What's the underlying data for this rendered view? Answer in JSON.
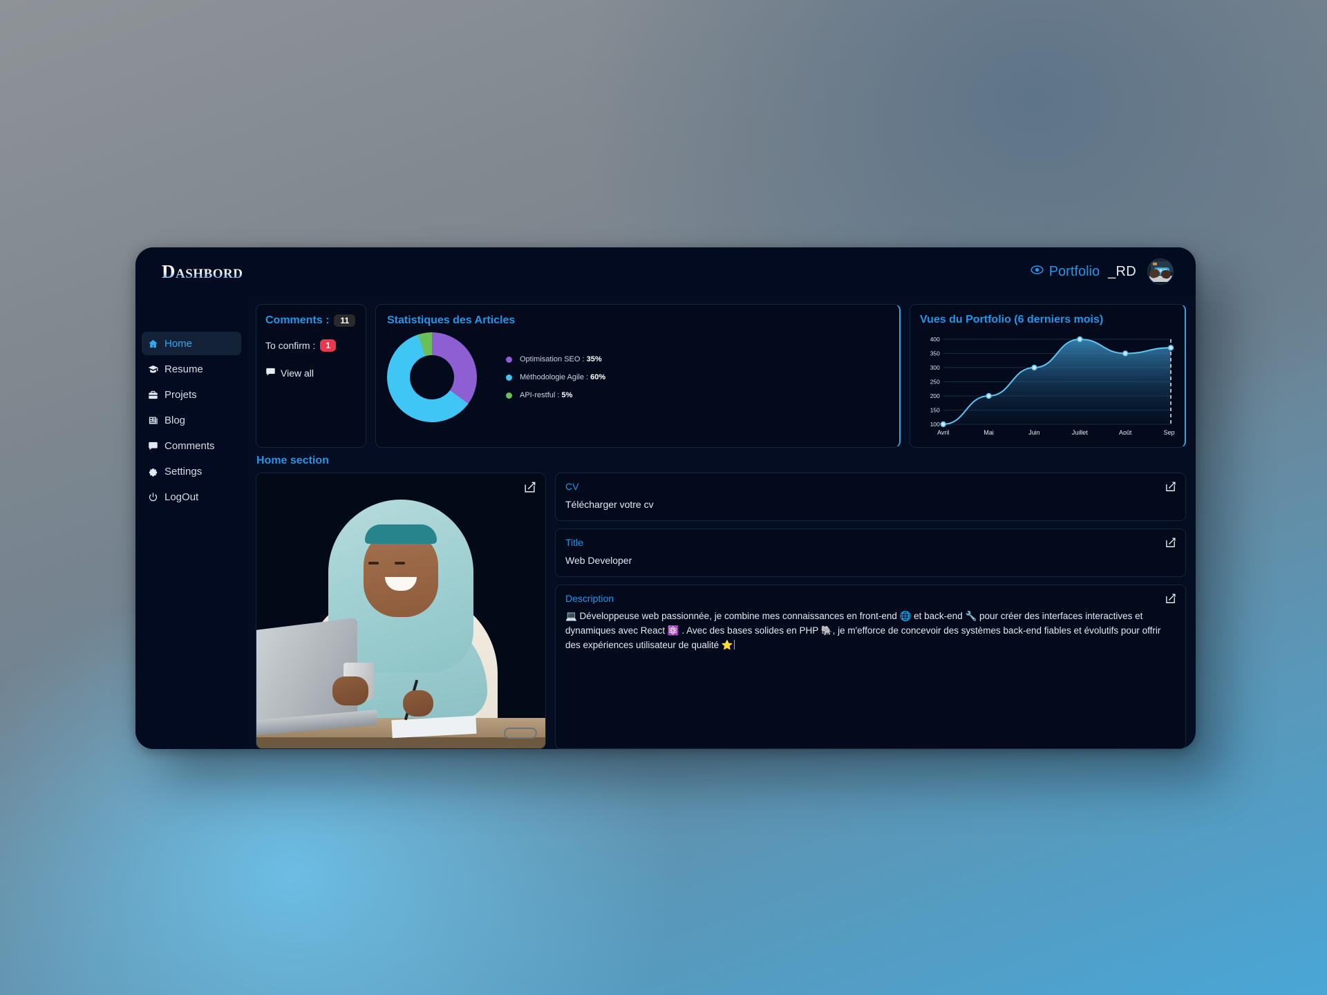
{
  "brand": "Dashbord",
  "header": {
    "portfolio_label": "Portfolio",
    "portfolio_icon": "eye-icon",
    "user_tag": "_RD",
    "avatar_alt": "user-avatar"
  },
  "sidebar": {
    "items": [
      {
        "label": "Home",
        "icon": "home-icon",
        "active": true
      },
      {
        "label": "Resume",
        "icon": "graduation-cap-icon",
        "active": false
      },
      {
        "label": "Projets",
        "icon": "briefcase-icon",
        "active": false
      },
      {
        "label": "Blog",
        "icon": "newspaper-icon",
        "active": false
      },
      {
        "label": "Comments",
        "icon": "comment-icon",
        "active": false
      },
      {
        "label": "Settings",
        "icon": "gear-icon",
        "active": false
      },
      {
        "label": "LogOut",
        "icon": "power-icon",
        "active": false
      }
    ]
  },
  "comments_card": {
    "title": "Comments :",
    "count": "11",
    "to_confirm_label": "To confirm :",
    "to_confirm_count": "1",
    "view_all_label": "View all",
    "view_all_icon": "comment-icon"
  },
  "stats_card": {
    "title": "Statistiques des Articles"
  },
  "views_card": {
    "title": "Vues du Portfolio (6 derniers mois)"
  },
  "section": {
    "home_section_label": "Home section",
    "photo_edit_icon": "edit-icon"
  },
  "fields": [
    {
      "label": "CV",
      "value": "Télécharger votre cv",
      "edit_icon": "edit-icon"
    },
    {
      "label": "Title",
      "value": "Web Developer",
      "edit_icon": "edit-icon"
    }
  ],
  "description": {
    "label": "Description",
    "edit_icon": "edit-icon",
    "value": "💻 Développeuse web passionnée, je combine mes connaissances en front-end 🌐 et back-end 🔧 pour créer des interfaces interactives et dynamiques avec React ⚛️ . Avec des bases solides en PHP 🐘, je m'efforce de concevoir des systèmes back-end fiables et évolutifs pour offrir des expériences utilisateur de qualité ⭐"
  },
  "colors": {
    "accent": "#2196e8",
    "accent_border": "#31a7e0",
    "badge_dark": "#2a2a2d",
    "badge_red": "#e8384f",
    "window_bg": "#020a1e",
    "card_bg": "#030a1c",
    "donut_purple": "#8d5fd3",
    "donut_cyan": "#3fc6f5",
    "donut_green": "#6bbf59",
    "line_stroke": "#5ec3f0"
  },
  "chart_data": [
    {
      "type": "pie",
      "title": "Statistiques des Articles",
      "legend_position": "right",
      "labels": [
        "Optimisation SEO",
        "Méthodologie Agile",
        "API-restful"
      ],
      "values": [
        35,
        60,
        5
      ],
      "value_labels": [
        "35%",
        "60%",
        "5%"
      ],
      "colors": [
        "#8d5fd3",
        "#3fc6f5",
        "#6bbf59"
      ],
      "donut": true
    },
    {
      "type": "line",
      "title": "Vues du Portfolio (6 derniers mois)",
      "categories": [
        "Avril",
        "Mai",
        "Juin",
        "Juillet",
        "Août",
        "Sept."
      ],
      "values": [
        100,
        200,
        300,
        400,
        350,
        370
      ],
      "xlabel": "",
      "ylabel": "",
      "ylim": [
        100,
        400
      ],
      "yticks": [
        100,
        150,
        200,
        250,
        300,
        350,
        400
      ],
      "grid": true,
      "area_fill": true,
      "markers": true,
      "annotation": "dashed-vertical-line-at-Sept"
    }
  ]
}
